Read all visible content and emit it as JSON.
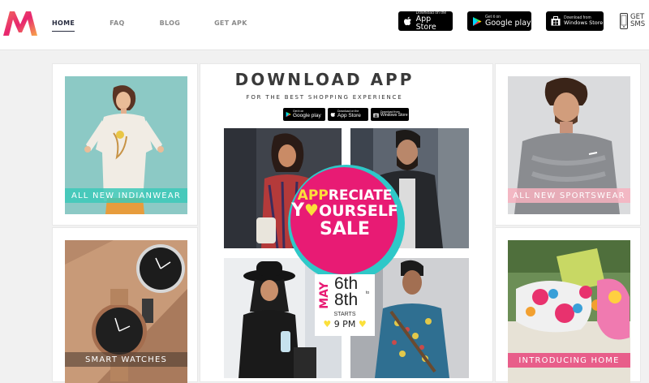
{
  "nav": {
    "items": [
      {
        "label": "HOME",
        "active": true
      },
      {
        "label": "FAQ"
      },
      {
        "label": "BLOG"
      },
      {
        "label": "GET APK"
      }
    ]
  },
  "stores": {
    "app_store": {
      "small": "Download on the",
      "big": "App Store"
    },
    "google_play": {
      "small": "Get it on",
      "big": "Google play"
    },
    "windows": {
      "small": "Download from",
      "big": "Windows Store"
    }
  },
  "sms": {
    "line1": "GET",
    "line2": "SMS"
  },
  "tiles": {
    "indianwear": "ALL NEW INDIANWEAR",
    "sportswear": "ALL NEW SPORTSWEAR",
    "watches": "SMART WATCHES",
    "home": "INTRODUCING HOME"
  },
  "promo": {
    "title": "DOWNLOAD APP",
    "subtitle": "FOR THE BEST SHOPPING EXPERIENCE",
    "mini_google": {
      "small": "Get it on",
      "big": "Google play"
    },
    "mini_apple": {
      "small": "Download on the",
      "big": "App Store"
    },
    "mini_windows": {
      "small": "Download from",
      "big": "Windows Store"
    },
    "sale": {
      "app": "APP",
      "reciate": "RECIATE",
      "y": "Y",
      "ourself": "OURSELF",
      "sale_word": "SALE",
      "may": "MAY",
      "d1": "6th",
      "to": "to",
      "d2": "8th",
      "starts": "STARTS",
      "time": "9 PM"
    }
  },
  "colors": {
    "brand_pink": "#e7256f",
    "brand_orange": "#f7a84a",
    "teal_label": "#3cc9b9",
    "pink_label": "#f7b1c0",
    "sale_pink": "#e81b74",
    "sale_yellow": "#fbe03a"
  }
}
